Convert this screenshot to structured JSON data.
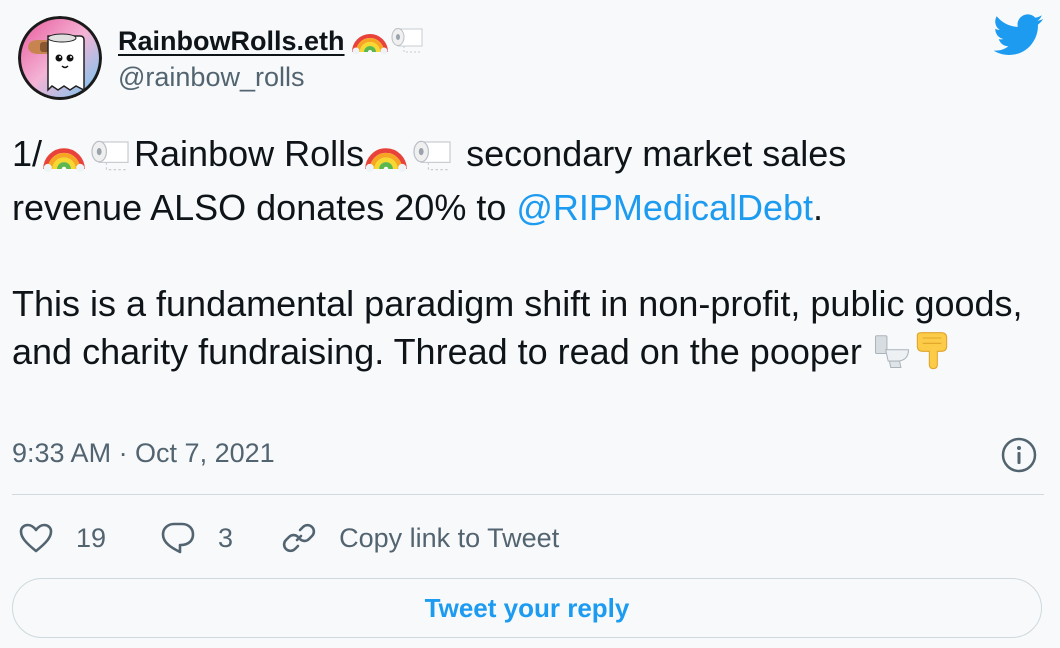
{
  "author": {
    "display_name": "RainbowRolls.eth",
    "handle": "@rainbow_rolls"
  },
  "tweet": {
    "text_prefix": "1/",
    "brand_name": "Rainbow Rolls",
    "line1_suffix": " secondary market sales",
    "line2_before_mention": "revenue ALSO donates 20% to ",
    "mention": "@RIPMedicalDebt",
    "line2_after_mention": ".",
    "para2": "This is a fundamental paradigm shift in non-profit, public goods, and charity fundraising. Thread to read on the pooper "
  },
  "meta": {
    "timestamp": "9:33 AM · Oct 7, 2021"
  },
  "actions": {
    "likes": "19",
    "replies": "3",
    "copy_link_label": "Copy link to Tweet"
  },
  "reply_button_label": "Tweet your reply",
  "colors": {
    "accent": "#1d9bf0",
    "secondary_text": "#536471",
    "border": "#cfd9de",
    "background": "#f7f9fa"
  },
  "icons": {
    "brand": "twitter-bird-icon",
    "like": "heart-outline-icon",
    "reply": "speech-bubble-icon",
    "copy": "link-icon",
    "info": "info-circle-icon",
    "emoji": [
      "rainbow-emoji",
      "toilet-paper-emoji",
      "toilet-emoji",
      "backhand-index-pointing-down-emoji"
    ]
  }
}
